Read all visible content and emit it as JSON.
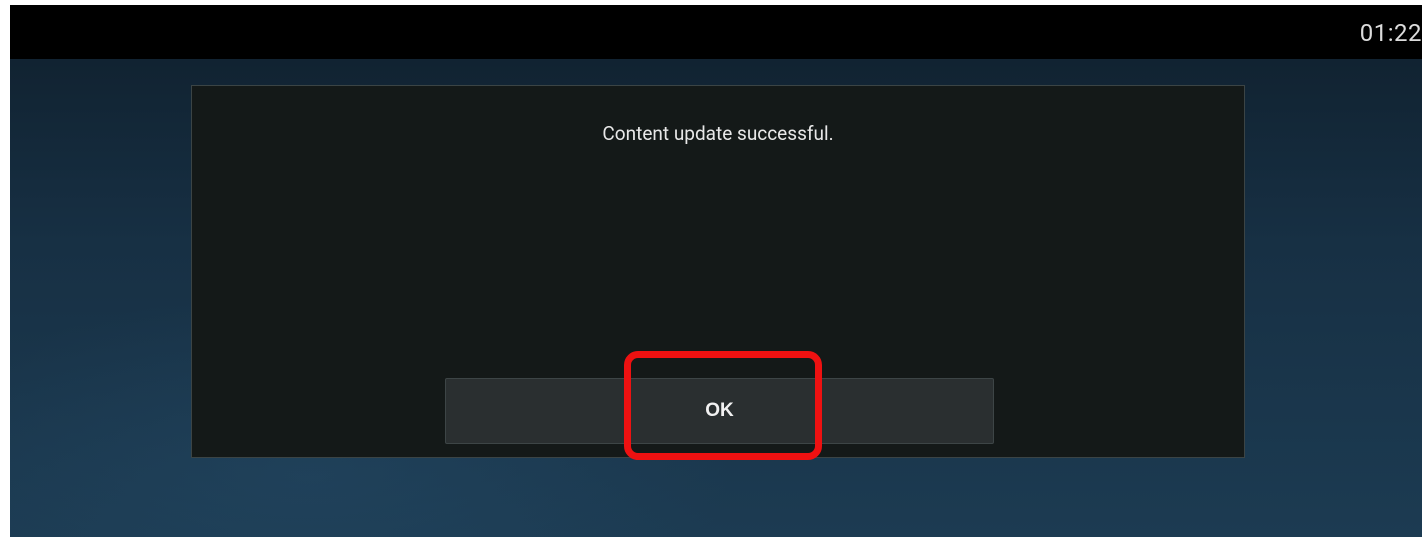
{
  "status_bar": {
    "time": "01:22"
  },
  "dialog": {
    "message": "Content update successful.",
    "ok_label": "OK"
  },
  "colors": {
    "status_bar_bg": "#000000",
    "dialog_bg": "#141918",
    "button_bg": "#2a2f30",
    "highlight": "#ee1111"
  }
}
